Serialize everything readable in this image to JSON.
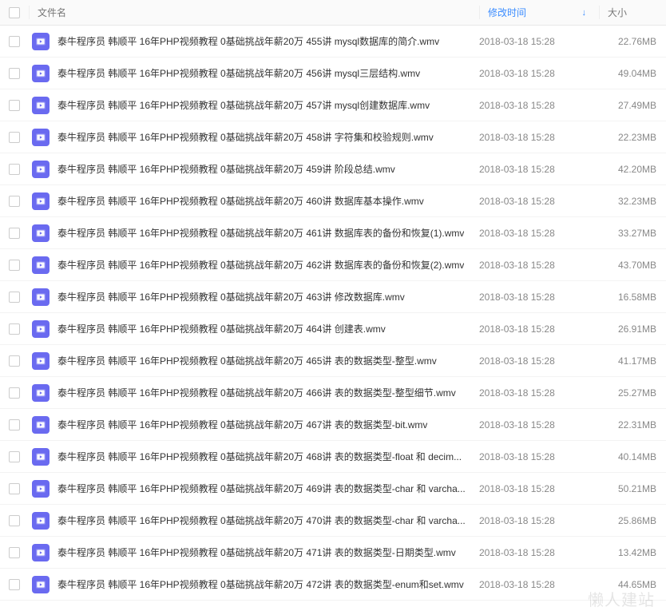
{
  "header": {
    "filename": "文件名",
    "modified": "修改时间",
    "size": "大小"
  },
  "sort_indicator": "↓",
  "watermark": "懒人建站",
  "files": [
    {
      "name": "泰牛程序员 韩顺平 16年PHP视频教程 0基础挑战年薪20万 455讲 mysql数据库的简介.wmv",
      "modified": "2018-03-18 15:28",
      "size": "22.76MB"
    },
    {
      "name": "泰牛程序员 韩顺平 16年PHP视频教程 0基础挑战年薪20万 456讲 mysql三层结构.wmv",
      "modified": "2018-03-18 15:28",
      "size": "49.04MB"
    },
    {
      "name": "泰牛程序员 韩顺平 16年PHP视频教程 0基础挑战年薪20万 457讲 mysql创建数据库.wmv",
      "modified": "2018-03-18 15:28",
      "size": "27.49MB"
    },
    {
      "name": "泰牛程序员 韩顺平 16年PHP视频教程 0基础挑战年薪20万 458讲 字符集和校验规则.wmv",
      "modified": "2018-03-18 15:28",
      "size": "22.23MB"
    },
    {
      "name": "泰牛程序员 韩顺平 16年PHP视频教程 0基础挑战年薪20万 459讲 阶段总结.wmv",
      "modified": "2018-03-18 15:28",
      "size": "42.20MB"
    },
    {
      "name": "泰牛程序员 韩顺平 16年PHP视频教程 0基础挑战年薪20万 460讲 数据库基本操作.wmv",
      "modified": "2018-03-18 15:28",
      "size": "32.23MB"
    },
    {
      "name": "泰牛程序员 韩顺平 16年PHP视频教程 0基础挑战年薪20万 461讲 数据库表的备份和恢复(1).wmv",
      "modified": "2018-03-18 15:28",
      "size": "33.27MB"
    },
    {
      "name": "泰牛程序员 韩顺平 16年PHP视频教程 0基础挑战年薪20万 462讲 数据库表的备份和恢复(2).wmv",
      "modified": "2018-03-18 15:28",
      "size": "43.70MB"
    },
    {
      "name": "泰牛程序员 韩顺平 16年PHP视频教程 0基础挑战年薪20万 463讲 修改数据库.wmv",
      "modified": "2018-03-18 15:28",
      "size": "16.58MB"
    },
    {
      "name": "泰牛程序员 韩顺平 16年PHP视频教程 0基础挑战年薪20万 464讲 创建表.wmv",
      "modified": "2018-03-18 15:28",
      "size": "26.91MB"
    },
    {
      "name": "泰牛程序员 韩顺平 16年PHP视频教程 0基础挑战年薪20万 465讲 表的数据类型-整型.wmv",
      "modified": "2018-03-18 15:28",
      "size": "41.17MB"
    },
    {
      "name": "泰牛程序员 韩顺平 16年PHP视频教程 0基础挑战年薪20万 466讲 表的数据类型-整型细节.wmv",
      "modified": "2018-03-18 15:28",
      "size": "25.27MB"
    },
    {
      "name": "泰牛程序员 韩顺平 16年PHP视频教程 0基础挑战年薪20万 467讲 表的数据类型-bit.wmv",
      "modified": "2018-03-18 15:28",
      "size": "22.31MB"
    },
    {
      "name": "泰牛程序员 韩顺平 16年PHP视频教程 0基础挑战年薪20万 468讲 表的数据类型-float 和 decim...",
      "modified": "2018-03-18 15:28",
      "size": "40.14MB"
    },
    {
      "name": "泰牛程序员 韩顺平 16年PHP视频教程 0基础挑战年薪20万 469讲 表的数据类型-char 和 varcha...",
      "modified": "2018-03-18 15:28",
      "size": "50.21MB"
    },
    {
      "name": "泰牛程序员 韩顺平 16年PHP视频教程 0基础挑战年薪20万 470讲 表的数据类型-char 和 varcha...",
      "modified": "2018-03-18 15:28",
      "size": "25.86MB"
    },
    {
      "name": "泰牛程序员 韩顺平 16年PHP视频教程 0基础挑战年薪20万 471讲 表的数据类型-日期类型.wmv",
      "modified": "2018-03-18 15:28",
      "size": "13.42MB"
    },
    {
      "name": "泰牛程序员 韩顺平 16年PHP视频教程 0基础挑战年薪20万 472讲 表的数据类型-enum和set.wmv",
      "modified": "2018-03-18 15:28",
      "size": "44.65MB"
    }
  ]
}
